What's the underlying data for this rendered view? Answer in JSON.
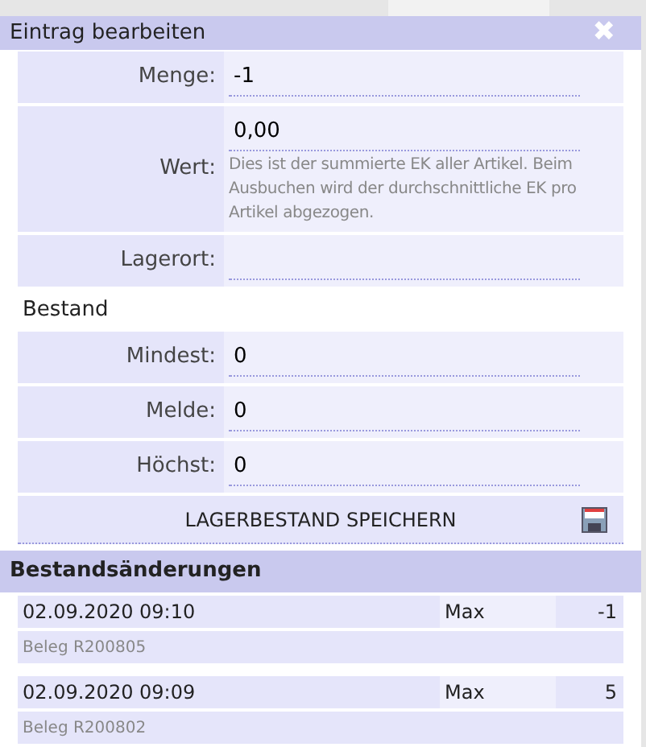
{
  "dialog": {
    "title": "Eintrag bearbeiten",
    "close": "✖"
  },
  "fields": [
    {
      "label": "Menge:",
      "value": "-1"
    },
    {
      "label": "Wert:",
      "value": "0,00",
      "hint": "Dies ist der summierte EK aller Artikel. Beim Ausbuchen wird der durchschnittliche EK pro Artikel abgezogen."
    },
    {
      "label": "Lagerort:"
    }
  ],
  "stock": {
    "heading": "Bestand",
    "fields": [
      {
        "label": "Mindest:",
        "value": "0"
      },
      {
        "label": "Melde:",
        "value": "0"
      },
      {
        "label": "Höchst:",
        "value": "0"
      }
    ],
    "save_button": "LAGERBESTAND SPEICHERN"
  },
  "changes": {
    "heading": "Bestandsänderungen",
    "entries": [
      {
        "date": "02.09.2020 09:10",
        "user": "Max",
        "amount": "-1",
        "document": "Beleg R200805"
      },
      {
        "date": "02.09.2020 09:09",
        "user": "Max",
        "amount": "5",
        "document": "Beleg R200802"
      }
    ]
  }
}
